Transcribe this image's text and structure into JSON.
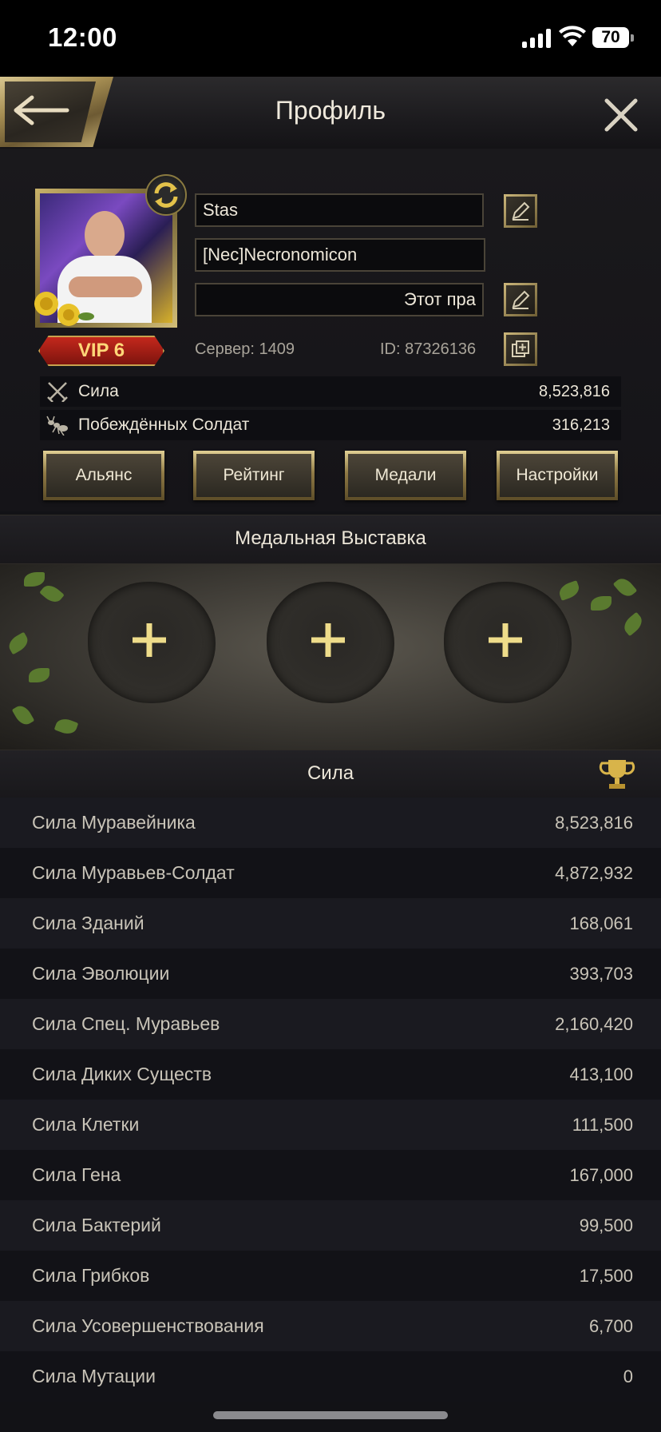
{
  "status_bar": {
    "time": "12:00",
    "battery": "70"
  },
  "header": {
    "title": "Профиль"
  },
  "profile": {
    "name": "Stas",
    "alliance": "[Nec]Necronomicon",
    "signature": "Этот пра",
    "vip": "VIP 6",
    "server": "Сервер: 1409",
    "id": "ID: 87326136"
  },
  "stats": [
    {
      "label": "Сила",
      "value": "8,523,816"
    },
    {
      "label": "Побеждённых Солдат",
      "value": "316,213"
    }
  ],
  "buttons": [
    "Альянс",
    "Рейтинг",
    "Медали",
    "Настройки"
  ],
  "medal_section": {
    "title": "Медальная Выставка"
  },
  "power_section": {
    "title": "Сила",
    "rows": [
      {
        "label": "Сила Муравейника",
        "value": "8,523,816"
      },
      {
        "label": "Сила Муравьев-Солдат",
        "value": "4,872,932"
      },
      {
        "label": "Сила Зданий",
        "value": "168,061"
      },
      {
        "label": "Сила Эволюции",
        "value": "393,703"
      },
      {
        "label": "Сила Спец. Муравьев",
        "value": "2,160,420"
      },
      {
        "label": "Сила Диких Существ",
        "value": "413,100"
      },
      {
        "label": "Сила Клетки",
        "value": "111,500"
      },
      {
        "label": "Сила Гена",
        "value": "167,000"
      },
      {
        "label": "Сила Бактерий",
        "value": "99,500"
      },
      {
        "label": "Сила Грибков",
        "value": "17,500"
      },
      {
        "label": "Сила Усовершенствования",
        "value": "6,700"
      },
      {
        "label": "Сила Мутации",
        "value": "0"
      }
    ]
  },
  "icons": {
    "back": "arrow-left-icon",
    "close": "close-icon",
    "edit": "pencil-icon",
    "copy": "copy-icon",
    "swap": "refresh-icon",
    "power": "crossed-swords-icon",
    "soldiers": "ant-icon",
    "trophy": "trophy-icon",
    "add": "plus-icon"
  },
  "colors": {
    "gold": "#c9b274",
    "vip_red": "#c3281c",
    "background": "#121216"
  }
}
